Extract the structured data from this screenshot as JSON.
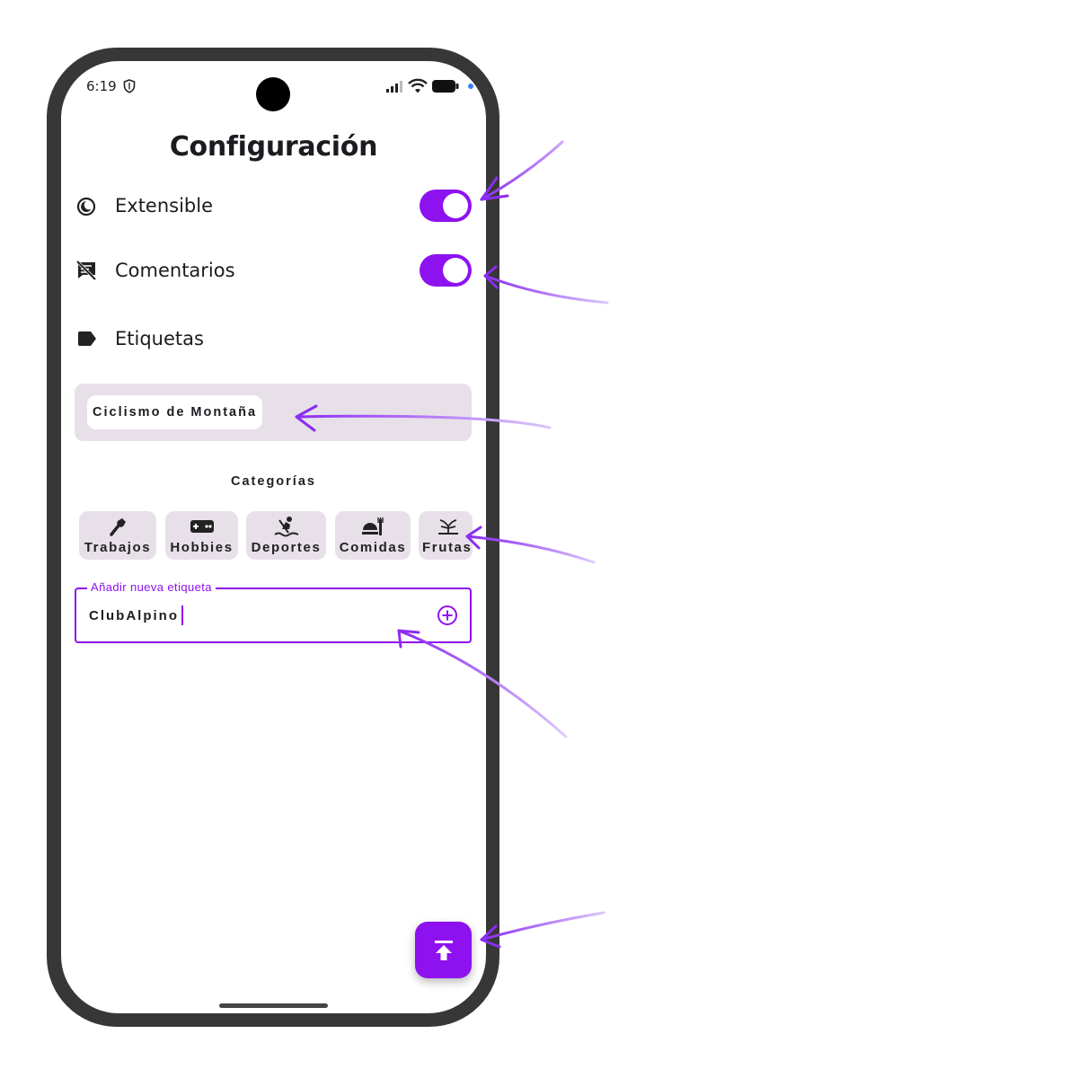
{
  "status_bar": {
    "time": "6:19",
    "icons": [
      "shield-icon",
      "signal-icon",
      "wifi-icon",
      "battery-icon",
      "notification-dot-icon"
    ]
  },
  "header": {
    "title": "Configuración"
  },
  "settings": {
    "extensible": {
      "label": "Extensible",
      "icon": "half-moon-icon",
      "toggle_on": true
    },
    "comentarios": {
      "label": "Comentarios",
      "icon": "comments-disabled-icon",
      "toggle_on": true
    },
    "etiquetas": {
      "label": "Etiquetas",
      "icon": "label-icon"
    }
  },
  "tags": [
    "Ciclismo de Montaña"
  ],
  "categories": {
    "title": "Categorías",
    "items": [
      {
        "label": "Trabajos",
        "icon": "tool-icon"
      },
      {
        "label": "Hobbies",
        "icon": "gamepad-icon"
      },
      {
        "label": "Deportes",
        "icon": "rowing-icon"
      },
      {
        "label": "Comidas",
        "icon": "dining-icon"
      },
      {
        "label": "Frutas",
        "icon": "plant-icon"
      }
    ]
  },
  "new_tag": {
    "label": "Añadir nueva etiqueta",
    "value": "ClubAlpino",
    "add_icon": "add-circle-icon"
  },
  "fab": {
    "icon": "upload-icon"
  },
  "colors": {
    "accent": "#8e11f0",
    "surface_variant": "#e7e0e9",
    "frame": "#373737",
    "annotation_arrow": "#9b3cf5"
  }
}
